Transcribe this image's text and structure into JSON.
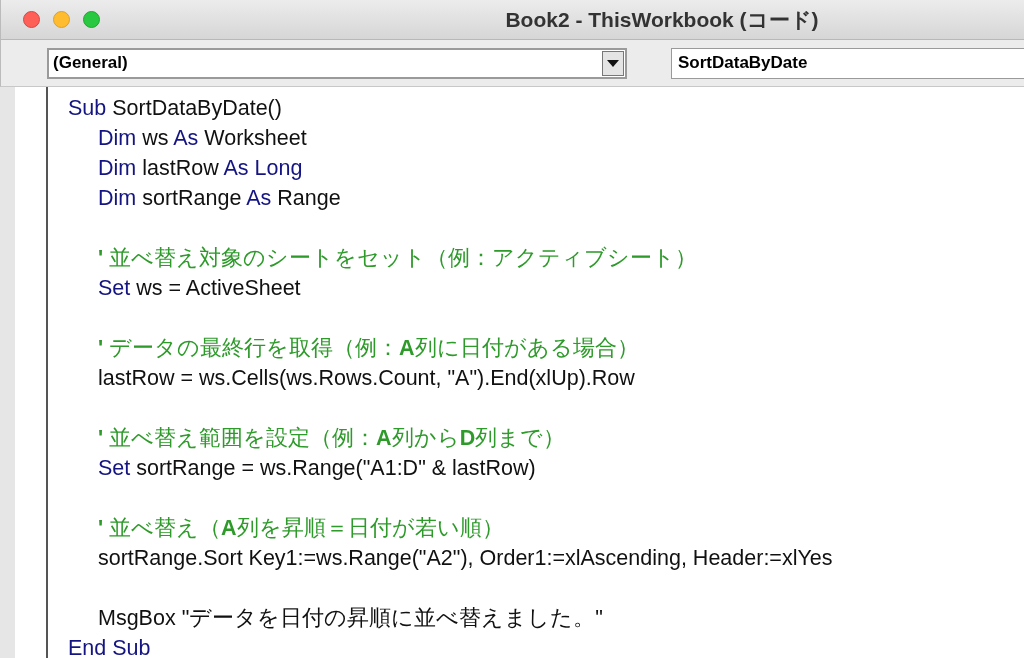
{
  "window": {
    "title": "Book2 - ThisWorkbook (コード)"
  },
  "toolbar": {
    "object_box": {
      "value": "(General)"
    },
    "procedure_box": {
      "value": "SortDataByDate"
    }
  },
  "code": {
    "header": [
      {
        "kind": "keyword",
        "text": "Sub"
      },
      {
        "kind": "code",
        "text": " SortDataByDate()"
      }
    ],
    "body": [
      [
        [
          {
            "kind": "keyword",
            "text": "Dim"
          },
          {
            "kind": "code",
            "text": " ws "
          },
          {
            "kind": "keyword",
            "text": "As"
          },
          {
            "kind": "code",
            "text": " Worksheet"
          }
        ],
        [
          {
            "kind": "keyword",
            "text": "Dim"
          },
          {
            "kind": "code",
            "text": " lastRow "
          },
          {
            "kind": "keyword",
            "text": "As"
          },
          {
            "kind": "keyword",
            "text": " Long"
          }
        ],
        [
          {
            "kind": "keyword",
            "text": "Dim"
          },
          {
            "kind": "code",
            "text": " sortRange "
          },
          {
            "kind": "keyword",
            "text": "As"
          },
          {
            "kind": "code",
            "text": " Range"
          }
        ]
      ],
      [
        [
          {
            "kind": "comment",
            "text": "**'** 並べ替え対象のシートをセット（例：アクティブシート）"
          }
        ],
        [
          {
            "kind": "keyword",
            "text": "Set"
          },
          {
            "kind": "code",
            "text": " ws = ActiveSheet"
          }
        ]
      ],
      [
        [
          {
            "kind": "comment",
            "text": "**'** データの最終行を取得（例：**A**列に日付がある場合）"
          }
        ],
        [
          {
            "kind": "code",
            "text": "lastRow = ws.Cells(ws.Rows.Count, \"A\").End(xlUp).Row"
          }
        ]
      ],
      [
        [
          {
            "kind": "comment",
            "text": "**'** 並べ替え範囲を設定（例：**A**列から**D**列まで）"
          }
        ],
        [
          {
            "kind": "keyword",
            "text": "Set"
          },
          {
            "kind": "code",
            "text": " sortRange = ws.Range(\"A1:D\" & lastRow)"
          }
        ]
      ],
      [
        [
          {
            "kind": "comment",
            "text": "**'** 並べ替え（**A**列を昇順＝日付が若い順）"
          }
        ],
        [
          {
            "kind": "code",
            "text": "sortRange.Sort Key1:=ws.Range(\"A2\"), Order1:=xlAscending, Header:=xlYes"
          }
        ]
      ],
      [
        [
          {
            "kind": "code",
            "text": "MsgBox \"データを日付の昇順に並べ替えました。\""
          }
        ]
      ]
    ],
    "footer": [
      {
        "kind": "keyword",
        "text": "End Sub"
      }
    ]
  }
}
